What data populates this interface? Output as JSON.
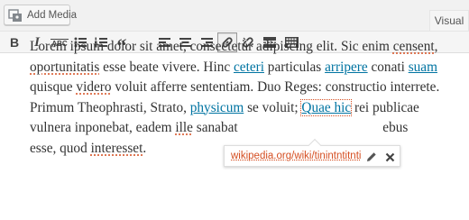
{
  "toolbar_top": {
    "add_media_label": "Add Media",
    "visual_tab_label": "Visual"
  },
  "format_toolbar": {
    "buttons": [
      {
        "name": "bold",
        "glyph": "B"
      },
      {
        "name": "italic",
        "glyph": "I"
      },
      {
        "name": "strikethrough",
        "glyph": "ABC"
      },
      {
        "name": "bulleted-list",
        "glyph": ""
      },
      {
        "name": "numbered-list",
        "glyph": ""
      },
      {
        "name": "blockquote",
        "glyph": "“"
      },
      {
        "name": "align-left",
        "glyph": ""
      },
      {
        "name": "align-center",
        "glyph": ""
      },
      {
        "name": "align-right",
        "glyph": ""
      },
      {
        "name": "insert-link",
        "glyph": "",
        "active": true
      },
      {
        "name": "remove-link",
        "glyph": ""
      },
      {
        "name": "read-more",
        "glyph": ""
      },
      {
        "name": "toolbar-toggle",
        "glyph": ""
      }
    ]
  },
  "content": {
    "lines": [
      [
        {
          "t": "Lorem ipsum dolor sit amet, consectetur adipiscing elit. Sic enim "
        },
        {
          "t": "censent",
          "spell": true
        },
        {
          "t": ","
        }
      ],
      [
        {
          "t": "oportunitatis",
          "spell": true
        },
        {
          "t": " esse beate vivere. Hinc "
        },
        {
          "t": "ceteri",
          "link": true
        },
        {
          "t": " particulas "
        },
        {
          "t": "arripere",
          "link": true
        },
        {
          "t": " conati "
        },
        {
          "t": "suam",
          "link": true
        }
      ],
      [
        {
          "t": "quisque "
        },
        {
          "t": "videro",
          "spell": true
        },
        {
          "t": " voluit afferre sententiam. Duo Reges: constructio interrete."
        }
      ],
      [
        {
          "t": "Primum Theophrasti, Strato, "
        },
        {
          "t": "physicum",
          "link": true
        },
        {
          "t": " se voluit; "
        },
        {
          "t": "Quae hic",
          "selected": true
        },
        {
          "t": " rei publicae"
        }
      ],
      [
        {
          "t": "vulnera inponebat, eadem "
        },
        {
          "t": "ille",
          "spell": true
        },
        {
          "t": " sanabat"
        },
        {
          "t": "                                          "
        },
        {
          "t": "ebus"
        }
      ],
      [
        {
          "t": "esse, quod "
        },
        {
          "t": "interesset",
          "spell": true
        },
        {
          "t": "."
        }
      ]
    ]
  },
  "link_popup": {
    "url": "wikipedia.org/wiki/tinintntitnti"
  },
  "colors": {
    "link": "#0074a2",
    "spellcheck": "#d54e21",
    "text": "#333333"
  }
}
